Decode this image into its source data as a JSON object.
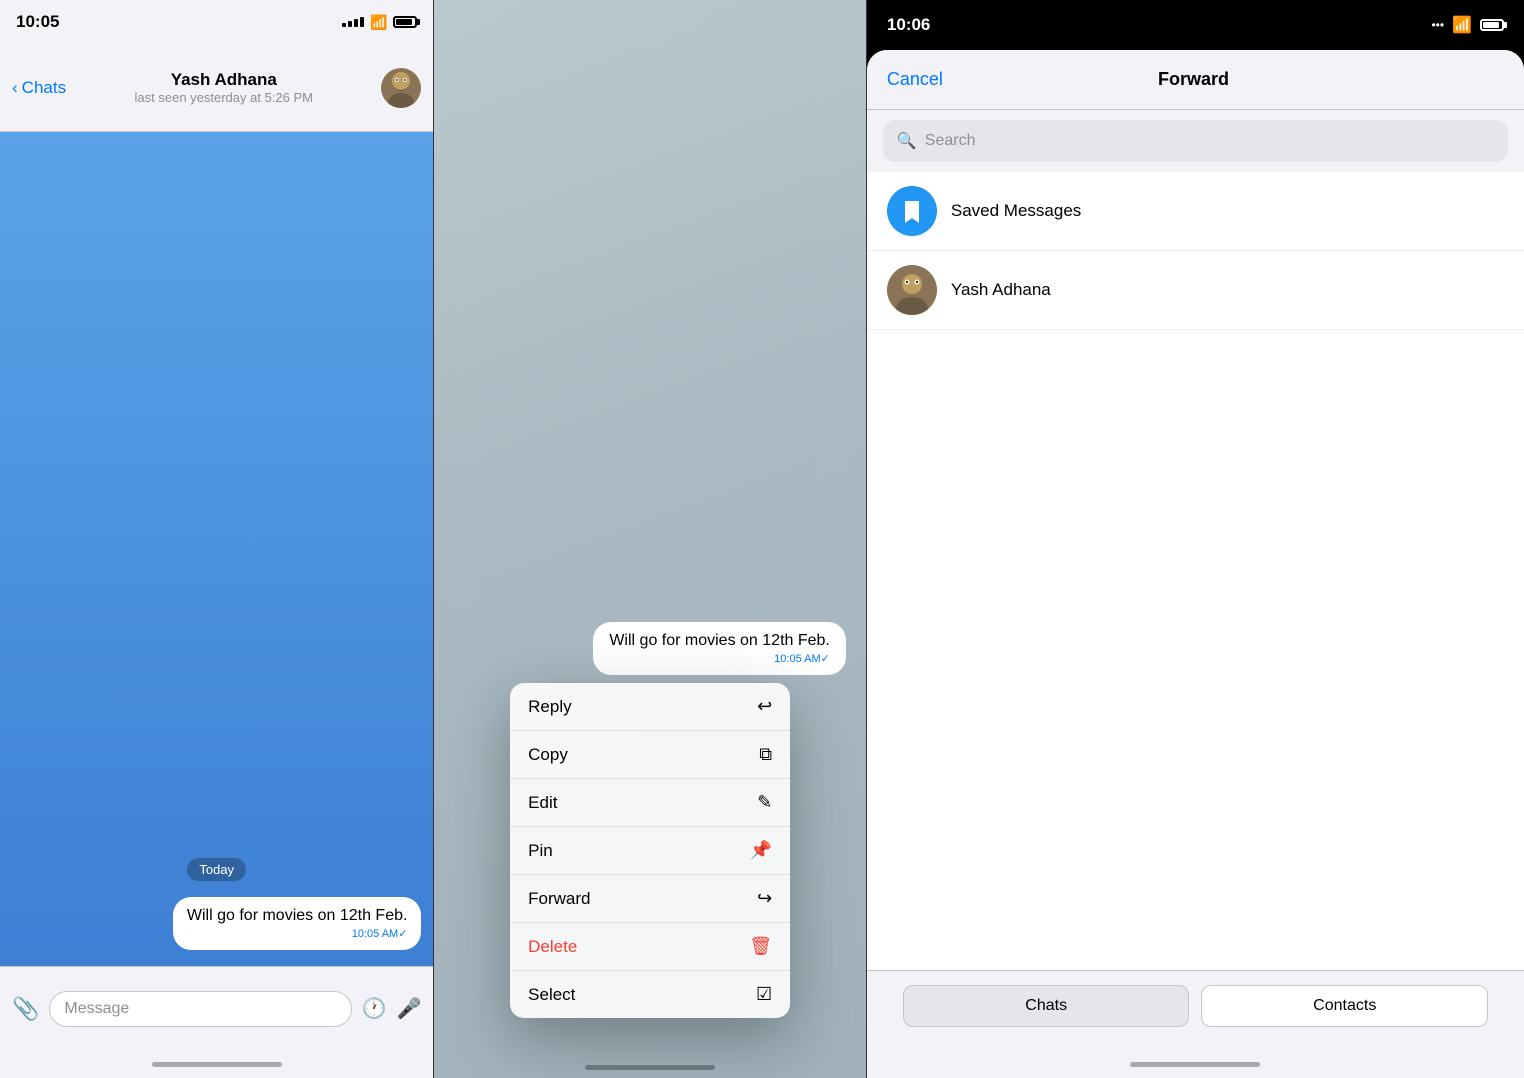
{
  "panel1": {
    "status_time": "10:05",
    "contact_name": "Yash Adhana",
    "contact_status": "last seen yesterday at 5:26 PM",
    "back_label": "Chats",
    "date_label": "Today",
    "message_text": "Will go for movies on 12th Feb.",
    "message_time": "10:05 AM✓",
    "input_placeholder": "Message"
  },
  "panel2": {
    "message_text": "Will go for movies on 12th Feb.",
    "message_time": "10:05 AM✓",
    "menu_items": [
      {
        "label": "Reply",
        "icon": "↩",
        "danger": false
      },
      {
        "label": "Copy",
        "icon": "⧉",
        "danger": false
      },
      {
        "label": "Edit",
        "icon": "✎",
        "danger": false
      },
      {
        "label": "Pin",
        "icon": "📌",
        "danger": false
      },
      {
        "label": "Forward",
        "icon": "↪",
        "danger": false
      },
      {
        "label": "Delete",
        "icon": "🗑",
        "danger": true
      },
      {
        "label": "Select",
        "icon": "☑",
        "danger": false
      }
    ]
  },
  "panel3": {
    "status_time": "10:06",
    "cancel_label": "Cancel",
    "title": "Forward",
    "search_placeholder": "Search",
    "contacts": [
      {
        "name": "Saved Messages",
        "type": "saved"
      },
      {
        "name": "Yash Adhana",
        "type": "contact"
      }
    ],
    "tab_chats": "Chats",
    "tab_contacts": "Contacts"
  }
}
